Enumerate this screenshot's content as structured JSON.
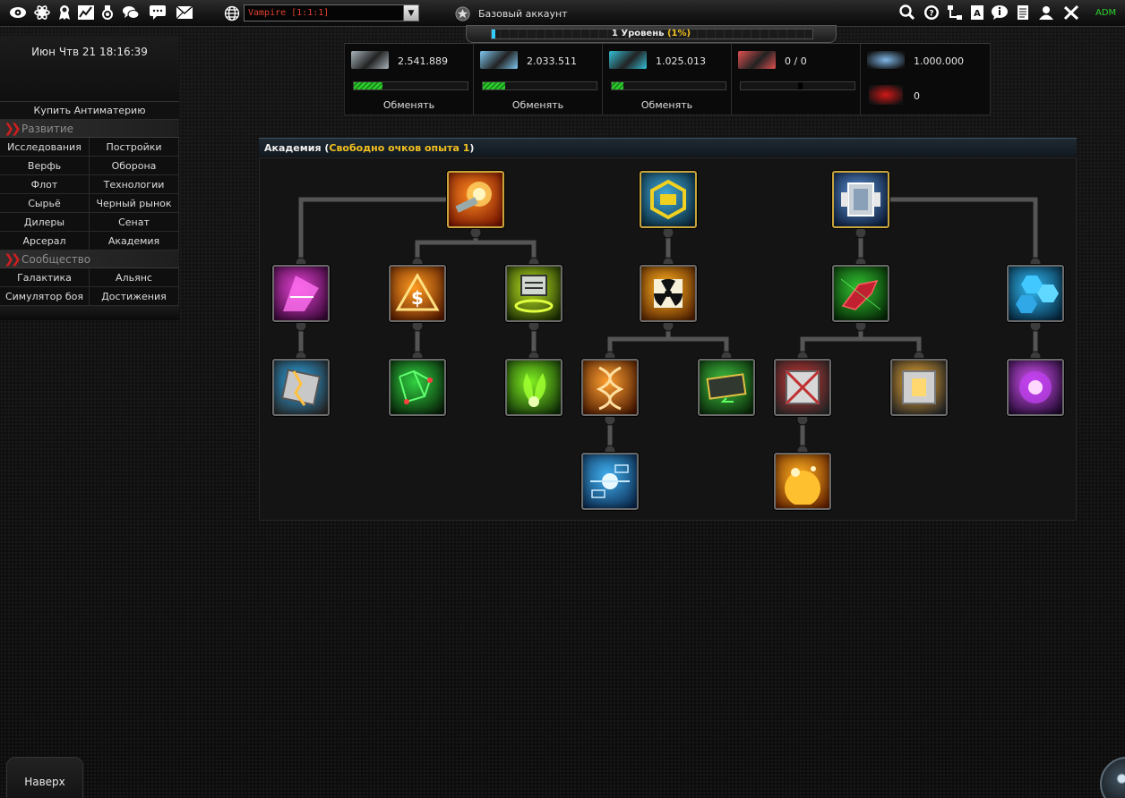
{
  "topbar": {
    "icons": [
      "eye-icon",
      "atom-icon",
      "medal-icon",
      "stats-icon",
      "trophy-icon",
      "chat-icon",
      "message-icon",
      "mail-icon"
    ],
    "right_icons": [
      "search-icon",
      "help-icon",
      "tree-icon",
      "notes-icon",
      "info-icon",
      "document-icon",
      "users-icon",
      "tools-icon"
    ],
    "planet": "Vampire [1:1:1]",
    "account": "Базовый аккаунт",
    "adm": "ADM"
  },
  "level": {
    "label": "1 Уровень",
    "percent": "(1%)",
    "progress": 0.01
  },
  "resources": [
    {
      "value": "2.541.889",
      "fill": 0.25,
      "exchange": "Обменять",
      "color": "#a8b4bc"
    },
    {
      "value": "2.033.511",
      "fill": 0.2,
      "exchange": "Обменять",
      "color": "#7fc8f0"
    },
    {
      "value": "1.025.013",
      "fill": 0.1,
      "exchange": "Обменять",
      "color": "#35c0d8"
    },
    {
      "value": "0 / 0",
      "marker": 0.5,
      "color": "#e05050"
    }
  ],
  "extra_resources": [
    {
      "value": "1.000.000",
      "color": "#7fb6e8"
    },
    {
      "value": "0",
      "color": "#d01818"
    }
  ],
  "clock": "Июн Чтв 21 18:16:39",
  "menu": {
    "buy": "Купить Антиматерию",
    "dev_title": "Развитие",
    "dev_items": [
      "Исследования",
      "Постройки",
      "Верфь",
      "Оборона",
      "Флот",
      "Технологии",
      "Сырьё",
      "Черный рынок",
      "Дилеры",
      "Сенат",
      "Арсерал",
      "Академия"
    ],
    "community_title": "Сообщество",
    "community_items": [
      "Галактика",
      "Альянс",
      "Симулятор боя",
      "Достижения"
    ]
  },
  "academy": {
    "title": "Академия",
    "points_label": "Свободно очков опыта 1"
  },
  "nodes": [
    {
      "name": "academy-node-attack",
      "icon": "attack-icon",
      "gold": true,
      "colors": [
        "#ff8a20",
        "#7a1400"
      ]
    },
    {
      "name": "academy-node-energy",
      "icon": "energy-icon",
      "gold": true,
      "colors": [
        "#3fa8d8",
        "#0b2a3c"
      ]
    },
    {
      "name": "academy-node-shield",
      "icon": "shield-plating-icon",
      "gold": true,
      "colors": [
        "#5a8ed0",
        "#0c1e3c"
      ]
    },
    {
      "name": "academy-node-pink",
      "icon": "crystal-icon",
      "gold": false,
      "colors": [
        "#e040d0",
        "#3a0838"
      ]
    },
    {
      "name": "academy-node-trade",
      "icon": "trade-icon",
      "gold": false,
      "colors": [
        "#ff9a20",
        "#5a1c00"
      ]
    },
    {
      "name": "academy-node-storage",
      "icon": "storage-icon",
      "gold": false,
      "colors": [
        "#b8e020",
        "#1c3004"
      ]
    },
    {
      "name": "academy-node-nuclear",
      "icon": "nuclear-icon",
      "gold": false,
      "colors": [
        "#ffb020",
        "#5a2400"
      ]
    },
    {
      "name": "academy-node-fleet",
      "icon": "fleet-icon",
      "gold": false,
      "colors": [
        "#30c030",
        "#062806"
      ]
    },
    {
      "name": "academy-node-hexshield",
      "icon": "hex-shield-icon",
      "gold": false,
      "colors": [
        "#30b8f0",
        "#062840"
      ]
    },
    {
      "name": "academy-node-armor",
      "icon": "armor-icon",
      "gold": false,
      "colors": [
        "#28a0e0",
        "#2a2a2a"
      ]
    },
    {
      "name": "academy-node-network",
      "icon": "network-icon",
      "gold": false,
      "colors": [
        "#30d040",
        "#082008"
      ]
    },
    {
      "name": "academy-node-bio",
      "icon": "bio-icon",
      "gold": false,
      "colors": [
        "#80f020",
        "#103008"
      ]
    },
    {
      "name": "academy-node-dna",
      "icon": "dna-icon",
      "gold": false,
      "colors": [
        "#ffa030",
        "#4a1800"
      ]
    },
    {
      "name": "academy-node-cargo",
      "icon": "cargo-icon",
      "gold": false,
      "colors": [
        "#40c040",
        "#0a2a0a"
      ]
    },
    {
      "name": "academy-node-structure",
      "icon": "structure-icon",
      "gold": false,
      "colors": [
        "#c03030",
        "#2a2a2a"
      ]
    },
    {
      "name": "academy-node-reactor",
      "icon": "reactor-icon",
      "gold": false,
      "colors": [
        "#e0a030",
        "#2a2a2a"
      ]
    },
    {
      "name": "academy-node-plasma",
      "icon": "plasma-icon",
      "gold": false,
      "colors": [
        "#d050f0",
        "#200a30"
      ]
    },
    {
      "name": "academy-node-computer",
      "icon": "computer-icon",
      "gold": false,
      "colors": [
        "#40b0f0",
        "#0a2a50"
      ]
    },
    {
      "name": "academy-node-solar",
      "icon": "solar-icon",
      "gold": false,
      "colors": [
        "#ffb020",
        "#6a2400"
      ]
    }
  ],
  "footer": {
    "top_button": "Наверх"
  }
}
